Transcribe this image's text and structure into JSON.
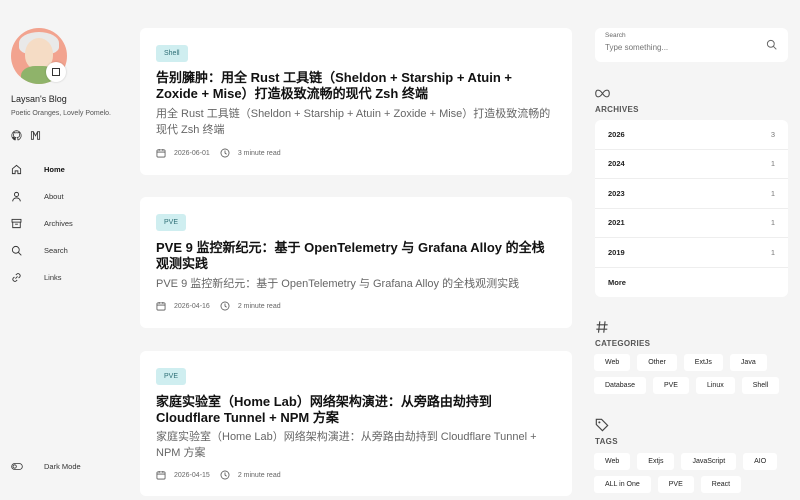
{
  "blog": {
    "title": "Laysan's Blog",
    "subtitle": "Poetic Oranges, Lovely Pomelo."
  },
  "social": [
    {
      "icon": "github-icon"
    },
    {
      "icon": "mastodon-icon"
    }
  ],
  "nav": [
    {
      "label": "Home",
      "icon": "home-icon",
      "active": true
    },
    {
      "label": "About",
      "icon": "user-icon"
    },
    {
      "label": "Archives",
      "icon": "archive-icon"
    },
    {
      "label": "Search",
      "icon": "search-icon"
    },
    {
      "label": "Links",
      "icon": "link-icon"
    }
  ],
  "dark_mode": {
    "label": "Dark Mode"
  },
  "posts": [
    {
      "tag": "Shell",
      "title": "告别臃肿：用全 Rust 工具链（Sheldon + Starship + Atuin + Zoxide + Mise）打造极致流畅的现代 Zsh 终端",
      "desc": "用全 Rust 工具链（Sheldon + Starship + Atuin + Zoxide + Mise）打造极致流畅的现代 Zsh 终端",
      "date": "2026-06-01",
      "read": "3 minute read"
    },
    {
      "tag": "PVE",
      "title": "PVE 9 监控新纪元：基于 OpenTelemetry 与 Grafana Alloy 的全栈观测实践",
      "desc": "PVE 9 监控新纪元：基于 OpenTelemetry 与 Grafana Alloy 的全栈观测实践",
      "date": "2026-04-16",
      "read": "2 minute read"
    },
    {
      "tag": "PVE",
      "title": "家庭实验室（Home Lab）网络架构演进：从旁路由劫持到 Cloudflare Tunnel + NPM 方案",
      "desc": "家庭实验室（Home Lab）网络架构演进：从旁路由劫持到 Cloudflare Tunnel + NPM 方案",
      "date": "2026-04-15",
      "read": "2 minute read"
    }
  ],
  "search": {
    "label": "Search",
    "placeholder": "Type something..."
  },
  "archives": {
    "title": "ARCHIVES",
    "rows": [
      {
        "year": "2026",
        "count": "3"
      },
      {
        "year": "2024",
        "count": "1"
      },
      {
        "year": "2023",
        "count": "1"
      },
      {
        "year": "2021",
        "count": "1"
      },
      {
        "year": "2019",
        "count": "1"
      }
    ],
    "more": "More"
  },
  "categories": {
    "title": "CATEGORIES",
    "items": [
      "Web",
      "Other",
      "ExtJs",
      "Java",
      "Database",
      "PVE",
      "Linux",
      "Shell"
    ]
  },
  "tags": {
    "title": "TAGS",
    "items": [
      "Web",
      "Extjs",
      "JavaScript",
      "AIO",
      "ALL in One",
      "PVE",
      "React"
    ]
  },
  "colors": {
    "tag_bg": "#cfeef0",
    "tag_text": "#2e6f76",
    "page_bg": "#f5f5f5"
  }
}
